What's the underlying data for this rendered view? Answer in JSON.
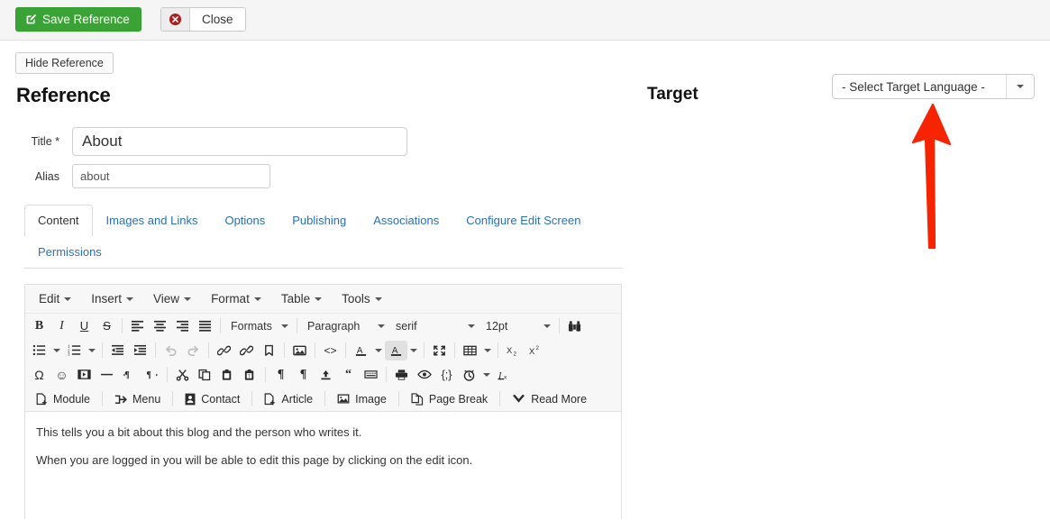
{
  "toolbar": {
    "save_label": "Save Reference",
    "save_icon": "edit-square-icon",
    "close_label": "Close",
    "close_icon": "cancel-circle-icon",
    "hide_reference_label": "Hide Reference"
  },
  "reference": {
    "heading": "Reference",
    "fields": {
      "title_label": "Title *",
      "title_value": "About",
      "alias_label": "Alias",
      "alias_value": "about"
    },
    "tabs": [
      {
        "label": "Content",
        "active": true
      },
      {
        "label": "Images and Links",
        "active": false
      },
      {
        "label": "Options",
        "active": false
      },
      {
        "label": "Publishing",
        "active": false
      },
      {
        "label": "Associations",
        "active": false
      },
      {
        "label": "Configure Edit Screen",
        "active": false
      },
      {
        "label": "Permissions",
        "active": false
      }
    ]
  },
  "target": {
    "heading": "Target",
    "language_select": {
      "value": "- Select Target Language -",
      "arrow_icon": "chevron-down-icon"
    }
  },
  "annotation": {
    "arrow_color": "#f62400",
    "arrow_direction": "up",
    "points_at": "language-select"
  },
  "editor": {
    "menubar": [
      {
        "label": "Edit"
      },
      {
        "label": "Insert"
      },
      {
        "label": "View"
      },
      {
        "label": "Format"
      },
      {
        "label": "Table"
      },
      {
        "label": "Tools"
      }
    ],
    "row1": {
      "bold": "B",
      "italic": "I",
      "underline": "U",
      "strikethrough": "S",
      "align_left": "align-left-icon",
      "align_center": "align-center-icon",
      "align_right": "align-right-icon",
      "align_justify": "align-justify-icon",
      "formats_label": "Formats",
      "block_label": "Paragraph",
      "font_label": "serif",
      "size_label": "12pt",
      "find_replace": "binoculars-icon"
    },
    "row2_icons": [
      "bullet-list-icon",
      "numbered-list-icon",
      "outdent-icon",
      "indent-icon",
      "undo-icon",
      "redo-icon",
      "link-icon",
      "unlink-icon",
      "anchor-icon",
      "image-icon",
      "source-code-icon",
      "text-color-icon",
      "background-color-icon",
      "fullscreen-icon",
      "table-icon",
      "subscript-icon",
      "superscript-icon"
    ],
    "row3_icons": [
      "special-character-icon",
      "emoticon-icon",
      "media-icon",
      "horizontal-rule-icon",
      "ltr-icon",
      "rtl-icon",
      "cut-icon",
      "copy-icon",
      "paste-icon",
      "paste-text-icon",
      "show-blocks-icon",
      "paragraph-icon",
      "insert-file-icon",
      "blockquote-icon",
      "nonbreaking-icon",
      "print-icon",
      "preview-icon",
      "template-icon",
      "insert-datetime-icon",
      "remove-format-icon"
    ],
    "buttons_row": [
      {
        "label": "Module",
        "icon": "module-icon"
      },
      {
        "label": "Menu",
        "icon": "menu-share-icon"
      },
      {
        "label": "Contact",
        "icon": "contact-card-icon"
      },
      {
        "label": "Article",
        "icon": "article-icon"
      },
      {
        "label": "Image",
        "icon": "picture-icon"
      },
      {
        "label": "Page Break",
        "icon": "page-break-icon"
      },
      {
        "label": "Read More",
        "icon": "read-more-icon"
      }
    ],
    "content": [
      "This tells you a bit about this blog and the person who writes it.",
      "When you are logged in you will be able to edit this page by clicking on the edit icon."
    ]
  }
}
